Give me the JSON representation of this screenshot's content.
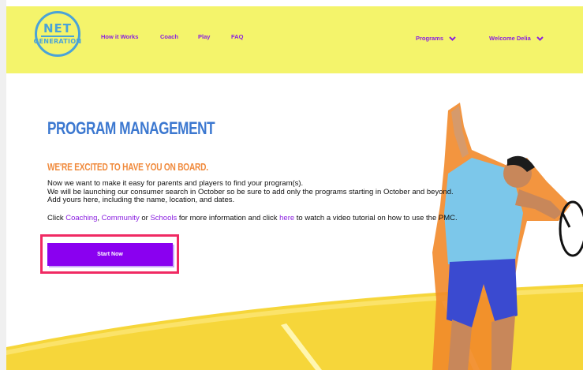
{
  "header": {
    "logo_text_top": "NET",
    "logo_text_bottom": "GENERATION",
    "nav": [
      {
        "label": "How it Works"
      },
      {
        "label": "Coach"
      },
      {
        "label": "Play"
      },
      {
        "label": "FAQ"
      }
    ],
    "programs_label": "Programs",
    "user_label": "Welcome Delia"
  },
  "main": {
    "title": "PROGRAM MANAGEMENT",
    "subtitle": "WE'RE EXCITED TO HAVE YOU ON BOARD.",
    "line1": "Now we want to make it easy for parents and players to find your program(s).",
    "line2": "We will be launching our consumer search in October so be sure to add only the programs starting in October and beyond.",
    "line3": "Add yours here, including the name, location, and dates.",
    "click_text": "Click ",
    "link_coaching": "Coaching",
    "comma": ", ",
    "link_community": "Community",
    "or_text": " or ",
    "link_schools": "Schools",
    "middle_text": " for more information and click ",
    "link_here": "here",
    "end_text": " to watch a video tutorial on how to use the PMC.",
    "start_button": "Start Now"
  },
  "colors": {
    "header_bg": "#f4f46b",
    "accent_purple": "#8a00f0",
    "title_blue": "#3c78d0",
    "subtitle_orange": "#f08a3c",
    "highlight_pink": "#f02a63"
  },
  "icons": {
    "dropdown": "chevron-down-icon"
  }
}
